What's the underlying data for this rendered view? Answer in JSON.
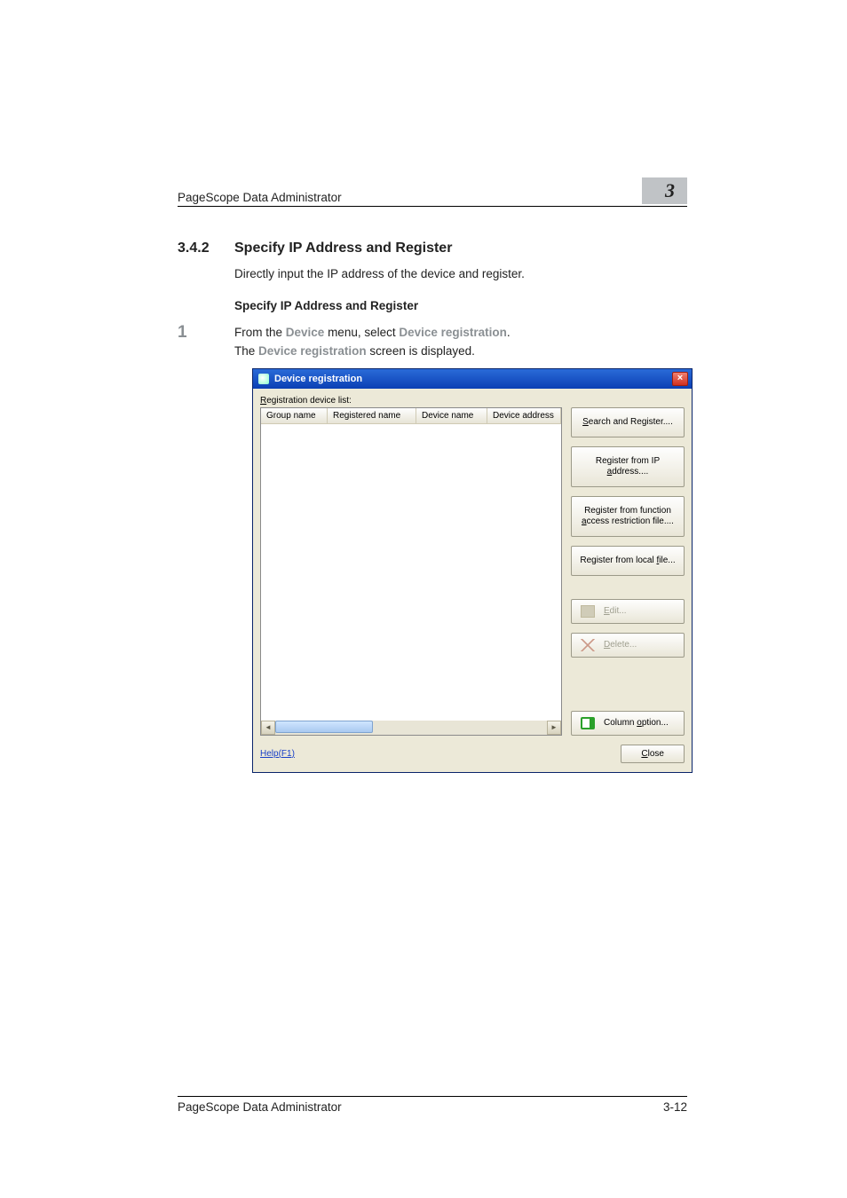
{
  "header": {
    "app_title": "PageScope Data Administrator",
    "chapter_num": "3"
  },
  "section": {
    "num": "3.4.2",
    "title": "Specify IP Address and Register",
    "intro": "Directly input the IP address of the device and register.",
    "subhead": "Specify IP Address and Register"
  },
  "step1": {
    "num": "1",
    "pre": "From the ",
    "kw1": "Device",
    "mid": " menu, select ",
    "kw2": "Device registration",
    "post": ".",
    "line2a": "The ",
    "line2kw": "Device registration",
    "line2b": " screen is displayed."
  },
  "dialog": {
    "title": "Device registration",
    "close_x": "×",
    "reg_list_prefix": "R",
    "reg_list_rest": "egistration device list:",
    "cols": {
      "c1": "Group name",
      "c2": "Registered name",
      "c3": "Device name",
      "c4": "Device address"
    },
    "scroll": {
      "left": "◄",
      "right": "►"
    },
    "buttons": {
      "search_u": "S",
      "search_rest": "earch and Register....",
      "reg_ip_line1": "Register from IP",
      "reg_ip_u": "a",
      "reg_ip_line2_rest": "ddress....",
      "reg_func_line1": "Register from function",
      "reg_func_u": "a",
      "reg_func_line2_rest": "ccess restriction file....",
      "reg_local": "Register from local ",
      "reg_local_u": "f",
      "reg_local_rest": "ile...",
      "edit_u": "E",
      "edit_rest": "dit...",
      "delete_u": "D",
      "delete_rest": "elete...",
      "colopt": "Column ",
      "colopt_u": "o",
      "colopt_rest": "ption..."
    },
    "footer": {
      "help": "Help(F1)",
      "close_u": "C",
      "close_rest": "lose"
    }
  },
  "footer": {
    "app_title": "PageScope Data Administrator",
    "page": "3-12"
  }
}
